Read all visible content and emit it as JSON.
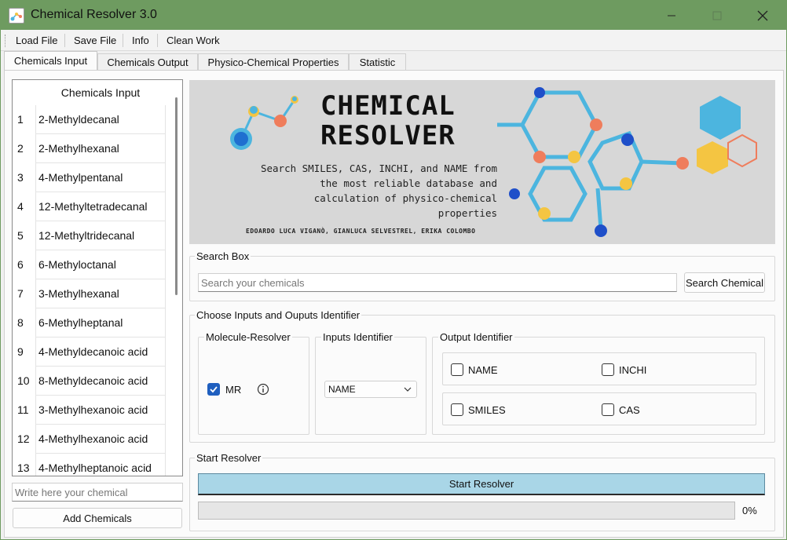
{
  "window": {
    "title": "Chemical Resolver 3.0"
  },
  "menu": [
    "Load File",
    "Save File",
    "Info",
    "Clean Work"
  ],
  "tabs": [
    "Chemicals Input",
    "Chemicals Output",
    "Physico-Chemical Properties",
    "Statistic"
  ],
  "chemicals_list": {
    "header": "Chemicals Input",
    "rows": [
      {
        "index": "1",
        "name": "2-Methyldecanal"
      },
      {
        "index": "2",
        "name": "2-Methylhexanal"
      },
      {
        "index": "3",
        "name": "4-Methylpentanal"
      },
      {
        "index": "4",
        "name": "12-Methyltetradecanal"
      },
      {
        "index": "5",
        "name": "12-Methyltridecanal"
      },
      {
        "index": "6",
        "name": "6-Methyloctanal"
      },
      {
        "index": "7",
        "name": "3-Methylhexanal"
      },
      {
        "index": "8",
        "name": "6-Methylheptanal"
      },
      {
        "index": "9",
        "name": "4-Methyldecanoic acid"
      },
      {
        "index": "10",
        "name": "8-Methyldecanoic acid"
      },
      {
        "index": "11",
        "name": "3-Methylhexanoic acid"
      },
      {
        "index": "12",
        "name": "4-Methylhexanoic acid"
      },
      {
        "index": "13",
        "name": "4-Methylheptanoic acid"
      }
    ]
  },
  "chemical_input": {
    "value": "",
    "placeholder": "Write here your chemical"
  },
  "add_button": "Add Chemicals",
  "banner": {
    "title_line1": "CHEMICAL",
    "title_line2": "RESOLVER",
    "subtitle_lines": [
      "Search SMILES, CAS, INCHI, and NAME from",
      "the most reliable database and",
      "calculation of physico-chemical",
      "properties"
    ],
    "authors": "EDOARDO LUCA VIGANÒ, GIANLUCA SELVESTREL, ERIKA COLOMBO"
  },
  "search_box": {
    "title": "Search Box",
    "input_value": "",
    "placeholder": "Search your chemicals",
    "button": "Search Chemical"
  },
  "identifiers": {
    "title": "Choose Inputs and Ouputs Identifier",
    "molecule_resolver": {
      "title": "Molecule-Resolver",
      "checkbox_label": "MR",
      "checked": true
    },
    "inputs_identifier": {
      "title": "Inputs Identifier",
      "selected": "NAME"
    },
    "output_identifier": {
      "title": "Output Identifier",
      "options": [
        {
          "label": "NAME",
          "checked": false
        },
        {
          "label": "INCHI",
          "checked": false
        },
        {
          "label": "SMILES",
          "checked": false
        },
        {
          "label": "CAS",
          "checked": false
        }
      ]
    }
  },
  "start": {
    "title": "Start Resolver",
    "button": "Start Resolver",
    "progress_value": 0,
    "progress_text": "0%"
  },
  "colors": {
    "titlebar": "#6e9b60",
    "start_button": "#a9d6e7",
    "checkbox_checked": "#1f5fbf",
    "molecule_blue": "#4cb5df",
    "molecule_orange": "#ef7d5c",
    "molecule_yellow": "#f4c542",
    "molecule_darkblue": "#1f4fc9"
  },
  "icons": {
    "app": "app-molecule-icon",
    "info": "info-circle-icon",
    "dropdown": "chevron-down-icon"
  }
}
